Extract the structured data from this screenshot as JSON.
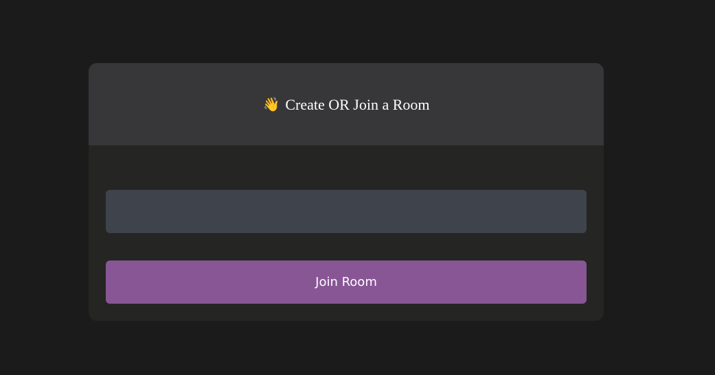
{
  "room_card": {
    "icon": "waving-hand-icon",
    "icon_glyph": "👋",
    "title": "Create OR Join a Room",
    "input": {
      "value": "",
      "placeholder": ""
    },
    "join_button_label": "Join Room"
  },
  "colors": {
    "page_background": "#1b1b1b",
    "header_background": "#373739",
    "body_background": "#252523",
    "input_background": "#3f444c",
    "button_background": "#885695"
  }
}
